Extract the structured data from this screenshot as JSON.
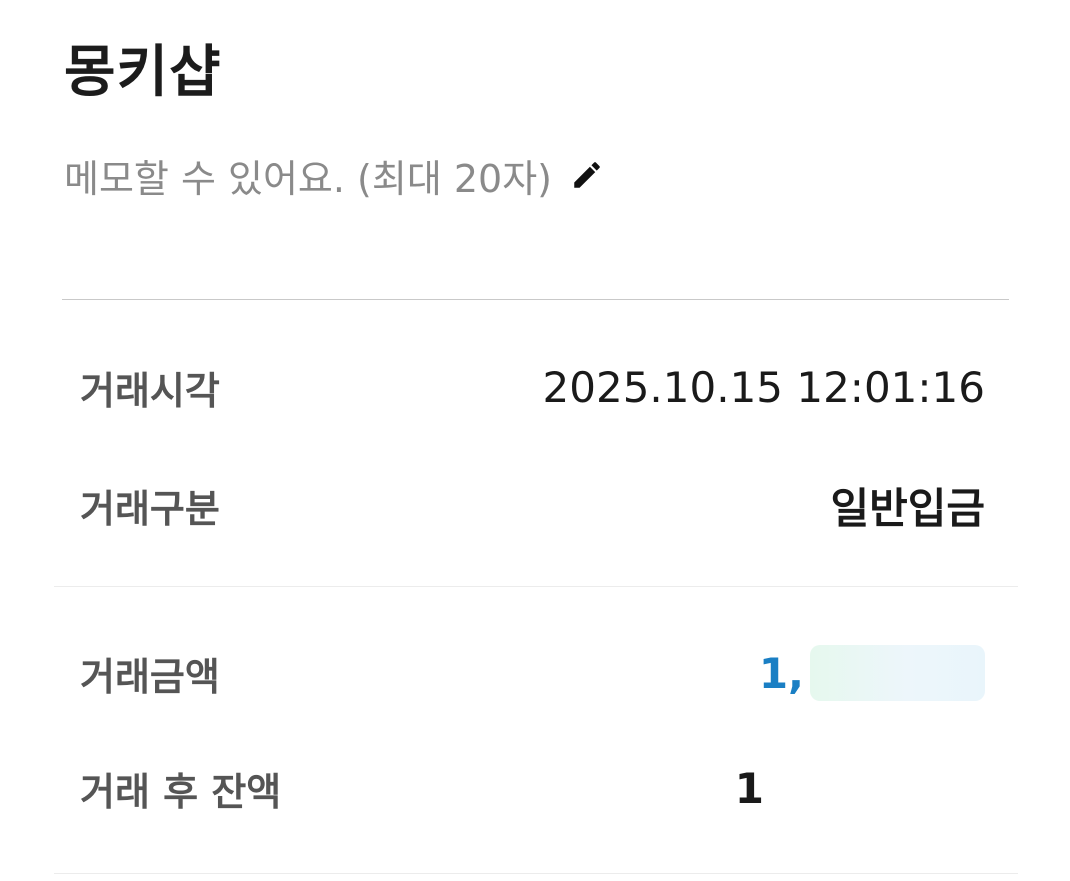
{
  "header": {
    "title": "몽키샵",
    "memo_placeholder": "메모할 수 있어요. (최대 20자)",
    "memo_edit_icon": "pencil-icon"
  },
  "details": {
    "time": {
      "label": "거래시각",
      "value": "2025.10.15 12:01:16"
    },
    "type": {
      "label": "거래구분",
      "value": "일반입금"
    },
    "amount": {
      "label": "거래금액",
      "value_visible": "1,",
      "masked": true,
      "color": "#1a7fc4"
    },
    "balance": {
      "label": "거래 후 잔액",
      "value_visible": "1",
      "masked": true
    }
  }
}
